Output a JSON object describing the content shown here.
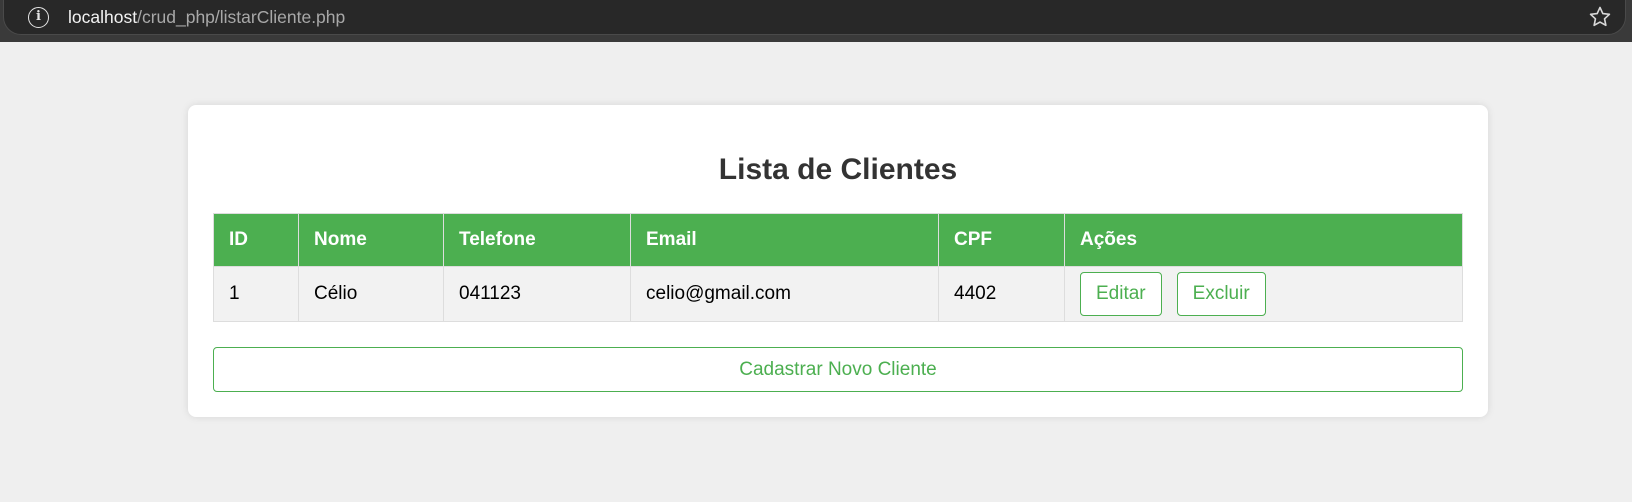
{
  "browser": {
    "url_host": "localhost",
    "url_path": "/crud_php/listarCliente.php"
  },
  "page": {
    "title": "Lista de Clientes"
  },
  "table": {
    "headers": [
      "ID",
      "Nome",
      "Telefone",
      "Email",
      "CPF",
      "Ações"
    ],
    "rows": [
      {
        "id": "1",
        "nome": "Célio",
        "telefone": "041123",
        "email": "celio@gmail.com",
        "cpf": "4402",
        "actions": {
          "edit_label": "Editar",
          "delete_label": "Excluir"
        }
      }
    ]
  },
  "new_client_button": {
    "label": "Cadastrar Novo Cliente"
  },
  "icons": {
    "info": "info-icon",
    "star": "star-icon"
  },
  "colors": {
    "accent": "#4caf50",
    "background": "#efefef",
    "card": "#ffffff",
    "title": "#333333",
    "row_bg": "#f2f2f2"
  }
}
